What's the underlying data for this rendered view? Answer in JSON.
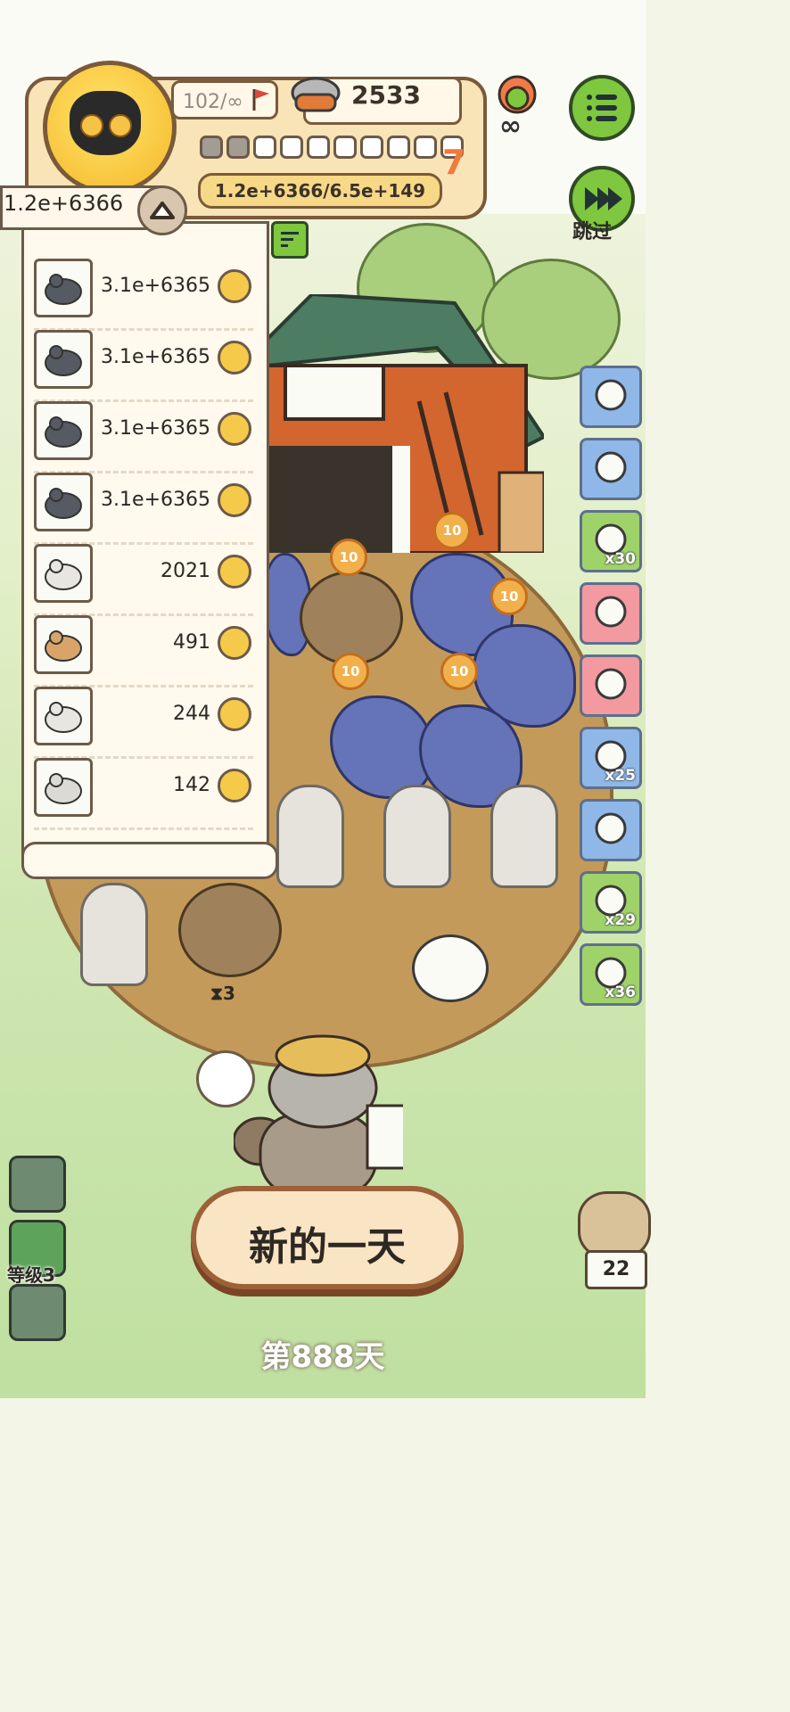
{
  "hud": {
    "capacity": "102/∞",
    "coins": "2533",
    "slots_total": 10,
    "slots_filled": 2,
    "level": "7",
    "population": "1.2e+6366/6.5e+149",
    "skip_label": "跳过",
    "flower_badge": "∞"
  },
  "list": {
    "total": "1.2e+6366",
    "rows": [
      {
        "animal": "mouse",
        "value": "3.1e+6365"
      },
      {
        "animal": "mouse",
        "value": "3.1e+6365"
      },
      {
        "animal": "mouse",
        "value": "3.1e+6365"
      },
      {
        "animal": "mouse",
        "value": "3.1e+6365"
      },
      {
        "animal": "rabbit",
        "value": "2021"
      },
      {
        "animal": "hamster",
        "value": "491"
      },
      {
        "animal": "rabbit",
        "value": "244"
      },
      {
        "animal": "alpaca",
        "value": "142"
      }
    ]
  },
  "toolbar": [
    {
      "icon": "ring-icon",
      "count": ""
    },
    {
      "icon": "machine-icon",
      "count": ""
    },
    {
      "icon": "ticket-icon",
      "count": "x30"
    },
    {
      "icon": "cloud-bird-icon",
      "count": ""
    },
    {
      "icon": "heart-potion-icon",
      "count": ""
    },
    {
      "icon": "seed-bag-icon",
      "count": "x25"
    },
    {
      "icon": "sheep-icon",
      "count": ""
    },
    {
      "icon": "tent-icon",
      "count": "x29"
    },
    {
      "icon": "worm-icon",
      "count": "x36"
    }
  ],
  "badges": [
    "10",
    "10",
    "10",
    "10",
    "10",
    "10"
  ],
  "timer": "3",
  "left_level": "等级3",
  "new_day_label": "新的一天",
  "day_label": "第888天",
  "owl_count": "22",
  "colors": {
    "accent_green": "#7ec73e",
    "panel_border": "#6c5a48",
    "level_orange": "#f07a3c"
  }
}
